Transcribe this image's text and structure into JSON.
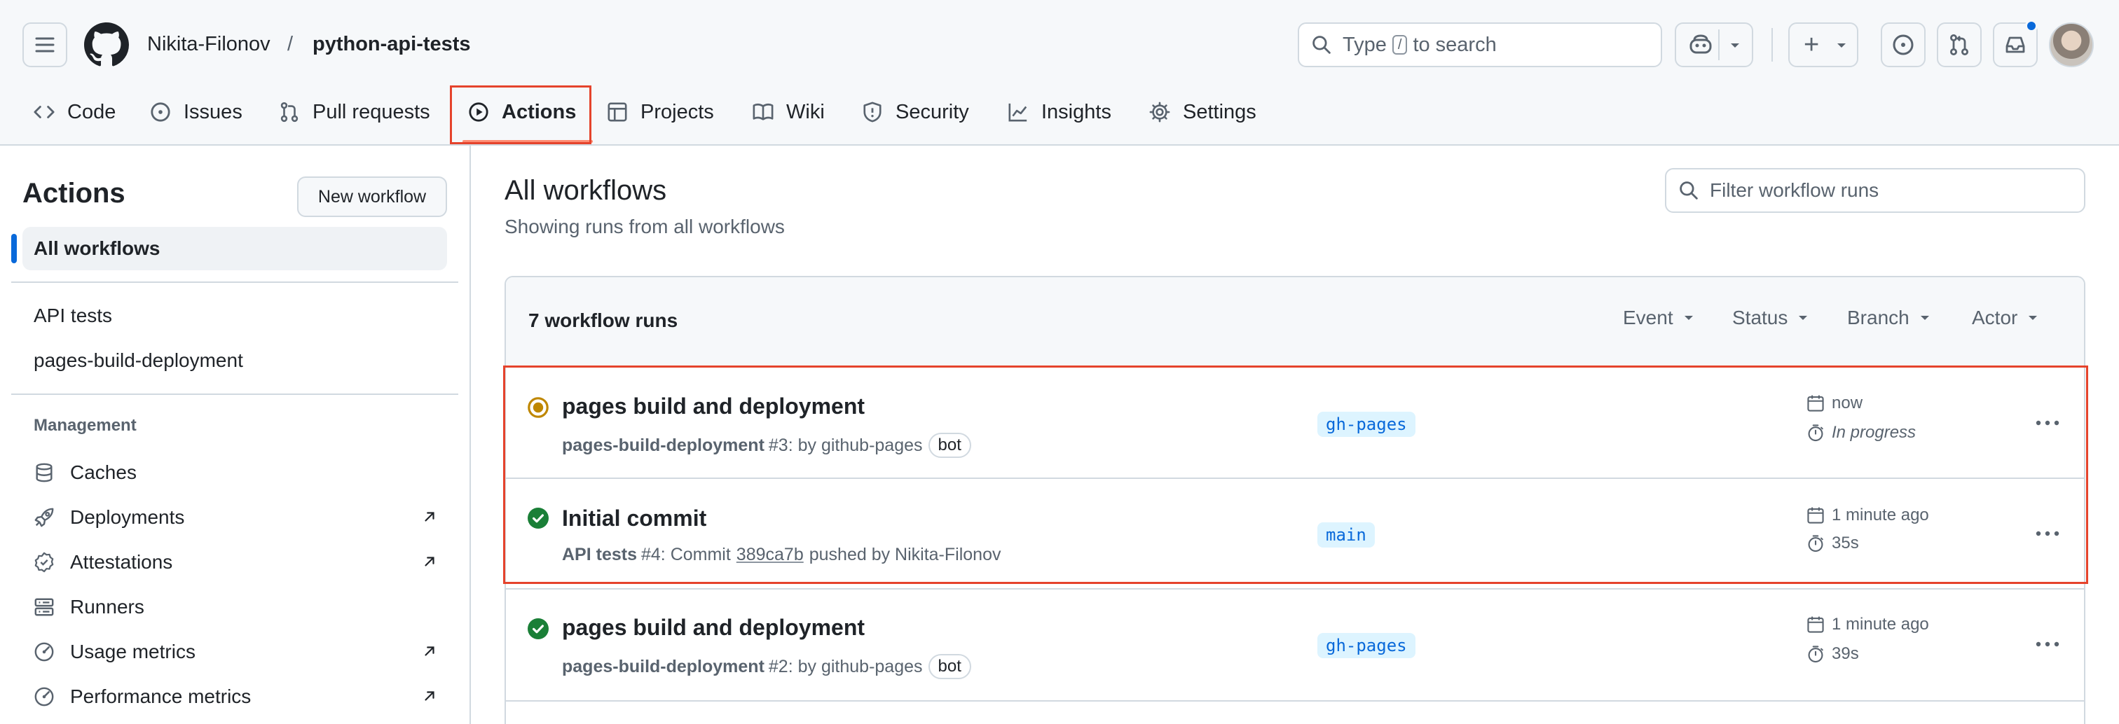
{
  "header": {
    "owner": "Nikita-Filonov",
    "separator": "/",
    "repo": "python-api-tests",
    "search_placeholder_pre": "Type",
    "search_key": "/",
    "search_placeholder_post": "to search",
    "plus_label": "+"
  },
  "nav": {
    "tabs": [
      {
        "label": "Code"
      },
      {
        "label": "Issues"
      },
      {
        "label": "Pull requests"
      },
      {
        "label": "Actions"
      },
      {
        "label": "Projects"
      },
      {
        "label": "Wiki"
      },
      {
        "label": "Security"
      },
      {
        "label": "Insights"
      },
      {
        "label": "Settings"
      }
    ],
    "active": "Actions"
  },
  "sidebar": {
    "title": "Actions",
    "new_workflow": "New workflow",
    "all_workflows": "All workflows",
    "workflows": [
      "API tests",
      "pages-build-deployment"
    ],
    "management_heading": "Management",
    "management": [
      {
        "label": "Caches",
        "icon": "database-icon",
        "external": false
      },
      {
        "label": "Deployments",
        "icon": "rocket-icon",
        "external": true
      },
      {
        "label": "Attestations",
        "icon": "verified-icon",
        "external": true
      },
      {
        "label": "Runners",
        "icon": "server-icon",
        "external": false
      },
      {
        "label": "Usage metrics",
        "icon": "meter-icon",
        "external": true
      },
      {
        "label": "Performance metrics",
        "icon": "meter-icon",
        "external": true
      }
    ]
  },
  "main": {
    "title": "All workflows",
    "subtitle": "Showing runs from all workflows",
    "filter_placeholder": "Filter workflow runs",
    "runs_count": "7 workflow runs",
    "facets": [
      "Event",
      "Status",
      "Branch",
      "Actor"
    ],
    "runs": [
      {
        "title": "pages build and deployment",
        "status": "in-progress",
        "workflow": "pages-build-deployment",
        "number": "#3",
        "meta_text": ": by github-pages",
        "bot": "bot",
        "branch": "gh-pages",
        "when": "now",
        "duration": "In progress"
      },
      {
        "title": "Initial commit",
        "status": "success",
        "workflow": "API tests",
        "number": "#4",
        "meta_text": ": Commit",
        "sha": "389ca7b",
        "meta_text_after": "pushed by Nikita-Filonov",
        "branch": "main",
        "when": "1 minute ago",
        "duration": "35s"
      },
      {
        "title": "pages build and deployment",
        "status": "success",
        "workflow": "pages-build-deployment",
        "number": "#2",
        "meta_text": ": by github-pages",
        "bot": "bot",
        "branch": "gh-pages",
        "when": "1 minute ago",
        "duration": "39s"
      }
    ]
  },
  "colors": {
    "accent": "#0969da",
    "success": "#1a7f37",
    "in_progress": "#bf8700",
    "highlight": "#e5432c",
    "tab_underline": "#fd8c73"
  }
}
